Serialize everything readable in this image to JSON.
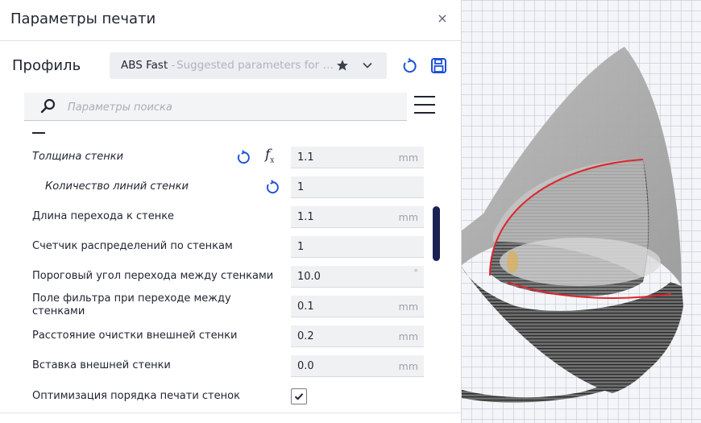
{
  "dialog": {
    "title": "Параметры печати",
    "close": "×"
  },
  "profile": {
    "label": "Профиль",
    "selected_name": "ABS Fast",
    "separator": " - ",
    "selected_description": "Suggested parameters for PLA, PETG",
    "icons": [
      "star-icon",
      "chevron-down-icon",
      "reset-icon",
      "save-icon"
    ]
  },
  "search": {
    "placeholder": "Параметры поиска"
  },
  "settings": [
    {
      "label": "Толщина стенки",
      "value": "1.1",
      "unit": "mm",
      "style": "italic",
      "has_reset": true,
      "has_fx": true
    },
    {
      "label": "Количество линий стенки",
      "value": "1",
      "unit": "",
      "style": "italic-indent",
      "has_reset": true,
      "has_fx": false
    },
    {
      "label": "Длина перехода к стенке",
      "value": "1.1",
      "unit": "mm"
    },
    {
      "label": "Счетчик распределений по стенкам",
      "value": "1",
      "unit": ""
    },
    {
      "label": "Пороговый угол перехода между стенками",
      "value": "10.0",
      "unit": "°"
    },
    {
      "label": "Поле фильтра при переходе между стенками",
      "value": "0.1",
      "unit": "mm"
    },
    {
      "label": "Расстояние очистки внешней стенки",
      "value": "0.2",
      "unit": "mm"
    },
    {
      "label": "Вставка внешней стенки",
      "value": "0.0",
      "unit": "mm"
    },
    {
      "label": "Оптимизация порядка печати стенок",
      "checked": true
    }
  ],
  "colors": {
    "accent": "#1b4fd9",
    "scrollbar": "#1b2253",
    "field_bg": "#f0f1f3",
    "model_outline": "#e0242a"
  }
}
